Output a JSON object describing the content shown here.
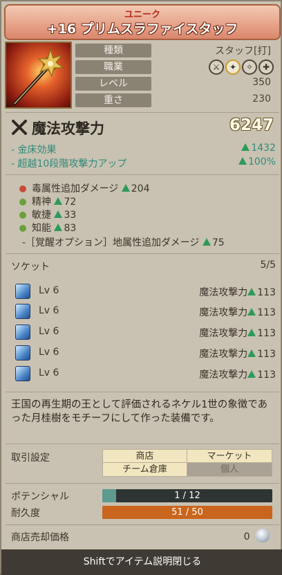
{
  "title": {
    "rarity": "ユニーク",
    "name": "+16 プリムスラファイスタッフ"
  },
  "stats": [
    {
      "label": "種類",
      "value": "スタッフ[打]"
    },
    {
      "label": "職業",
      "value": ""
    },
    {
      "label": "レベル",
      "value": "350"
    },
    {
      "label": "重さ",
      "value": "230"
    }
  ],
  "class_icons": [
    "sword-class-icon",
    "staff-class-icon",
    "mage-class-icon",
    "cross-class-icon"
  ],
  "main_stat": {
    "label": "魔法攻撃力",
    "value": "6247"
  },
  "bonuses": [
    {
      "label": "- 金床効果",
      "value": "1432"
    },
    {
      "label": "- 超越10段階攻撃力アップ",
      "value": "100%"
    }
  ],
  "substats": [
    {
      "label": "毒属性追加ダメージ",
      "value": "204",
      "dot": "#c94b3a"
    },
    {
      "label": "精神",
      "value": "72",
      "dot": "#6aa03a"
    },
    {
      "label": "敏捷",
      "value": "33",
      "dot": "#6aa03a"
    },
    {
      "label": "知能",
      "value": "83",
      "dot": "#6aa03a"
    }
  ],
  "awakening": {
    "label": "-［覚醒オプション］地属性追加ダメージ",
    "value": "75"
  },
  "socket": {
    "title": "ソケット",
    "count": "5/5",
    "rows": [
      {
        "level": "Lv 6",
        "stat": "魔法攻撃力",
        "value": "113"
      },
      {
        "level": "Lv 6",
        "stat": "魔法攻撃力",
        "value": "113"
      },
      {
        "level": "Lv 6",
        "stat": "魔法攻撃力",
        "value": "113"
      },
      {
        "level": "Lv 6",
        "stat": "魔法攻撃力",
        "value": "113"
      },
      {
        "level": "Lv 6",
        "stat": "魔法攻撃力",
        "value": "113"
      }
    ]
  },
  "description": "王国の再生期の王として評価されるネケル1世の象徴であった月桂樹をモチーフにして作った装備です。",
  "trade": {
    "label": "取引設定",
    "shop": "商店",
    "market": "マーケット",
    "storage": "チーム倉庫",
    "personal": "個人"
  },
  "potential": {
    "label": "ポテンシャル",
    "value": "1 / 12",
    "fill": 0.0833
  },
  "durability": {
    "label": "耐久度",
    "value": "51 / 50",
    "fill": 1.0
  },
  "sell": {
    "label": "商店売却価格",
    "value": "0"
  },
  "footer": {
    "text": "Shiftでアイテム説明閉じる"
  },
  "colors": {
    "accent": "#b3281b",
    "bonus": "#2f8a7a",
    "durability": "#c9651c",
    "potential": "#2e3433"
  }
}
